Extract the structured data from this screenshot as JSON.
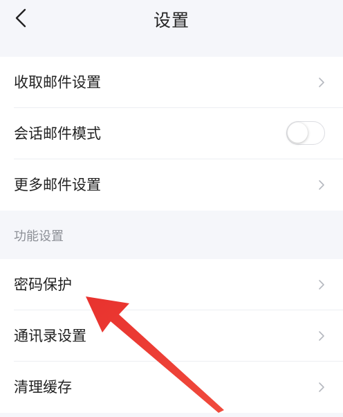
{
  "header": {
    "title": "设置",
    "back_icon": "chevron-left-icon"
  },
  "mail_group": {
    "items": [
      {
        "label": "收取邮件设置",
        "control": "chevron"
      },
      {
        "label": "会话邮件模式",
        "control": "toggle",
        "toggle_on": false
      },
      {
        "label": "更多邮件设置",
        "control": "chevron"
      }
    ]
  },
  "function_section": {
    "label": "功能设置",
    "items": [
      {
        "label": "密码保护",
        "control": "chevron"
      },
      {
        "label": "通讯录设置",
        "control": "chevron"
      },
      {
        "label": "清理缓存",
        "control": "chevron"
      }
    ]
  },
  "annotation": {
    "type": "arrow",
    "color": "#e8322e",
    "points_to": "密码保护"
  },
  "colors": {
    "background": "#f5f6fa",
    "card": "#ffffff",
    "chevron": "#b5b8bf"
  }
}
